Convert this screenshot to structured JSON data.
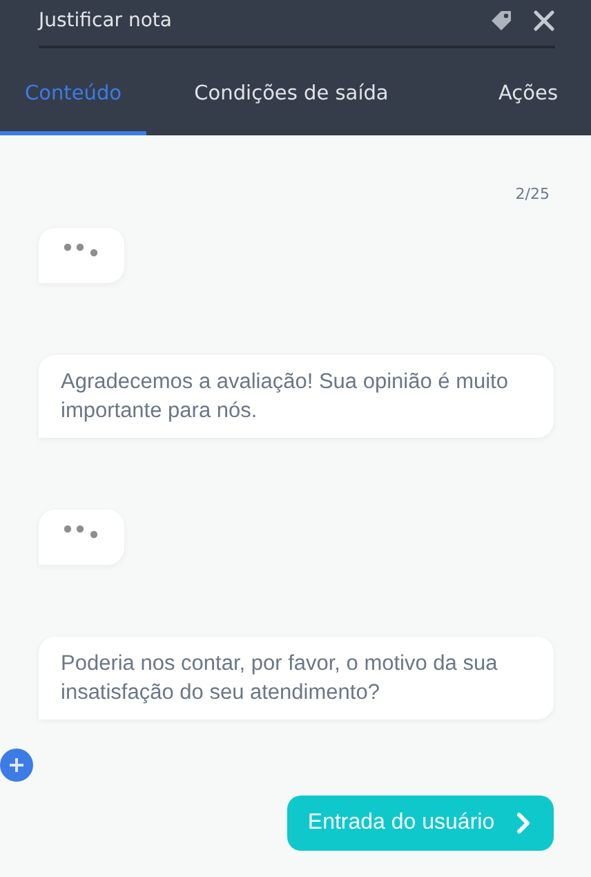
{
  "header": {
    "title": "Justificar nota"
  },
  "tabs": [
    {
      "label": "Conteúdo",
      "selected": true
    },
    {
      "label": "Condições de saída",
      "selected": false
    },
    {
      "label": "Ações",
      "selected": false
    }
  ],
  "counter": "2/25",
  "messages": [
    {
      "kind": "typing"
    },
    {
      "kind": "text",
      "text": "Agradecemos a avaliação! Sua opinião é muito importante para nós."
    },
    {
      "kind": "typing"
    },
    {
      "kind": "text",
      "text": "Poderia nos contar, por favor, o motivo da sua insatisfação do seu atendimento?"
    }
  ],
  "user_input_button": "Entrada do usuário"
}
